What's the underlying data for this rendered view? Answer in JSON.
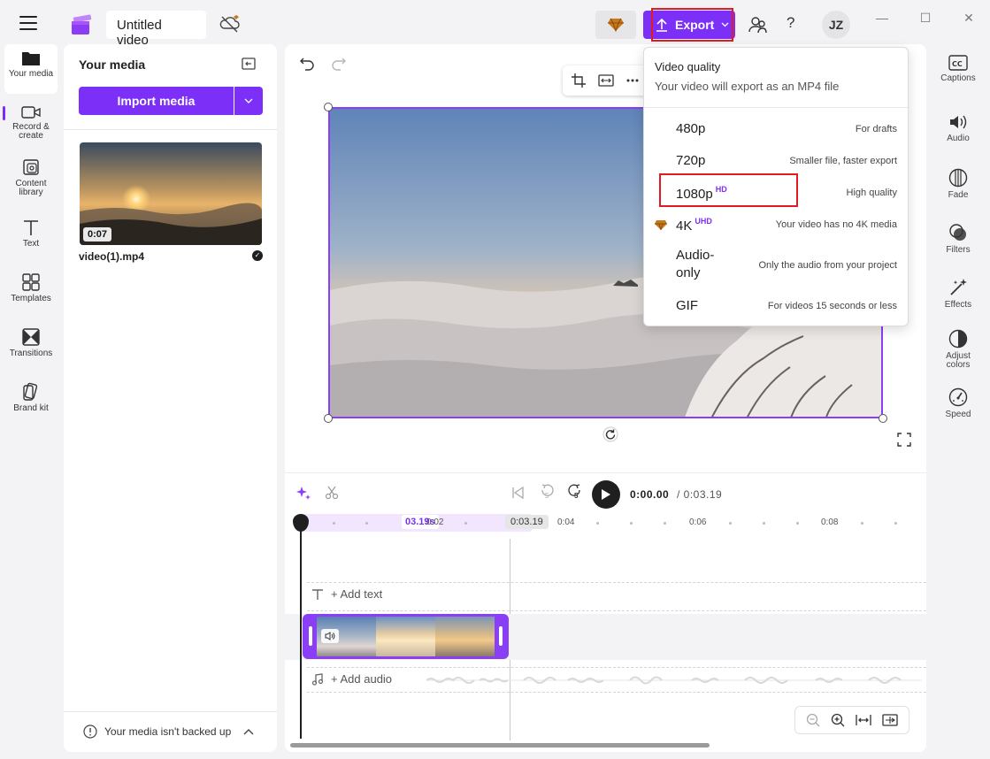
{
  "app": {
    "project_title": "Untitled video",
    "export_label": "Export",
    "avatar_initials": "JZ",
    "help_label": "?"
  },
  "left_rail": {
    "items": [
      {
        "label": "Your media",
        "icon": "folder-icon"
      },
      {
        "label": "Record & create",
        "icon": "camera-icon"
      },
      {
        "label": "Content library",
        "icon": "library-icon"
      },
      {
        "label": "Text",
        "icon": "text-icon"
      },
      {
        "label": "Templates",
        "icon": "templates-icon"
      },
      {
        "label": "Transitions",
        "icon": "transitions-icon"
      },
      {
        "label": "Brand kit",
        "icon": "brand-kit-icon"
      }
    ]
  },
  "media_panel": {
    "title": "Your media",
    "import_label": "Import media",
    "items": [
      {
        "name": "video(1).mp4",
        "duration": "0:07"
      }
    ],
    "backup_notice": "Your media isn't backed up"
  },
  "timeline": {
    "current_time": "0:00.00",
    "total_time": "/ 0:03.19",
    "skip_back_label": "5",
    "skip_fwd_label": "5",
    "ruler": {
      "selection_label": "03.19s",
      "end_label": "0:03.19",
      "ticks": [
        "0:02",
        "0:04",
        "0:06",
        "0:08"
      ]
    },
    "add_text_label": "+ Add text",
    "add_audio_label": "+ Add audio"
  },
  "right_rail": {
    "items": [
      {
        "label": "Captions",
        "icon": "captions-icon"
      },
      {
        "label": "Audio",
        "icon": "audio-icon"
      },
      {
        "label": "Fade",
        "icon": "fade-icon"
      },
      {
        "label": "Filters",
        "icon": "filters-icon"
      },
      {
        "label": "Effects",
        "icon": "effects-icon"
      },
      {
        "label": "Adjust colors",
        "icon": "adjust-colors-icon"
      },
      {
        "label": "Speed",
        "icon": "speed-icon"
      }
    ]
  },
  "export_menu": {
    "title": "Video quality",
    "subtitle": "Your video will export as an MP4 file",
    "options": [
      {
        "label": "480p",
        "badge": "",
        "description": "For drafts"
      },
      {
        "label": "720p",
        "badge": "",
        "description": "Smaller file, faster export"
      },
      {
        "label": "1080p",
        "badge": "HD",
        "description": "High quality"
      },
      {
        "label": "4K",
        "badge": "UHD",
        "description": "Your video has no 4K media"
      },
      {
        "label": "Audio-only",
        "badge": "",
        "description": "Only the audio from your project"
      },
      {
        "label": "GIF",
        "badge": "",
        "description": "For videos 15 seconds or less"
      }
    ]
  },
  "colors": {
    "accent": "#7b2ff7",
    "highlight_outline": "#e01b24",
    "premium_gem": "#c8791c"
  }
}
